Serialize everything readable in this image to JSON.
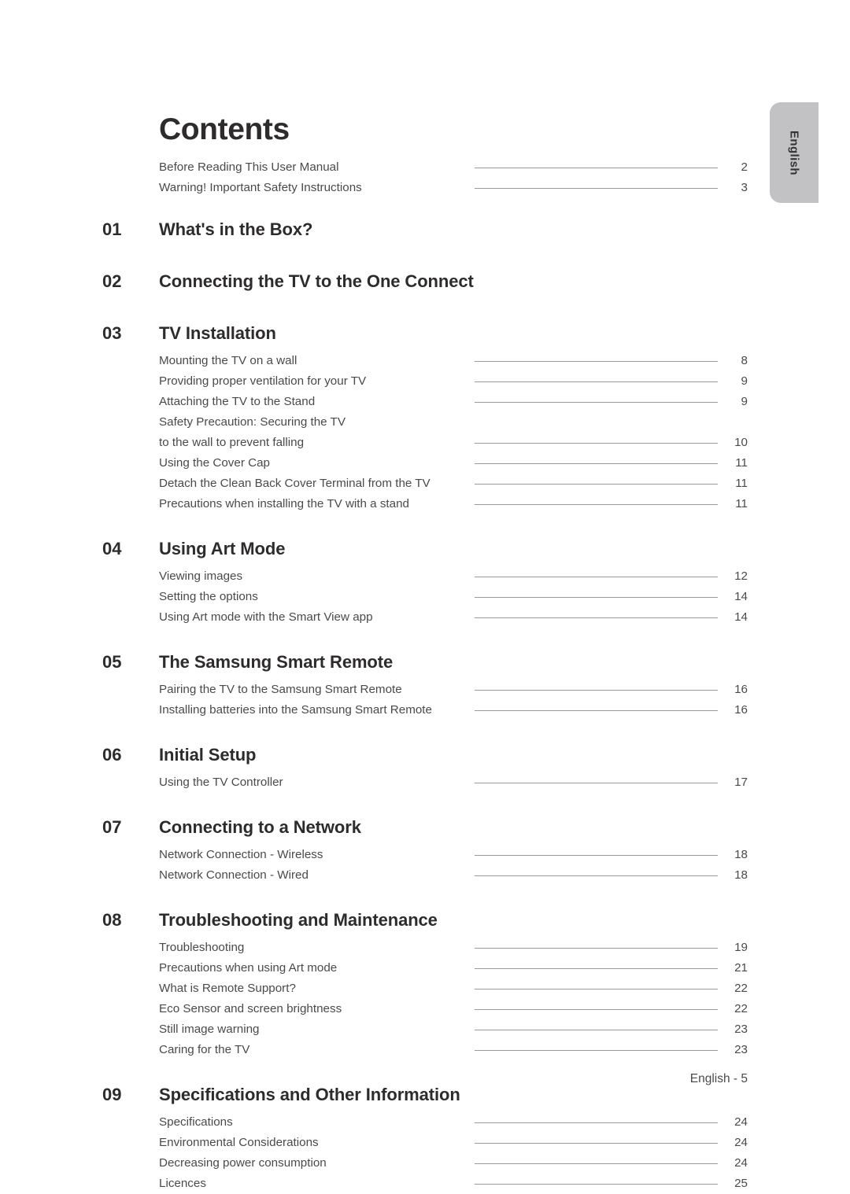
{
  "page": {
    "title": "Contents",
    "footer": "English - 5",
    "side_tab_label": "English",
    "side_tab_color": "#c2c2c4",
    "text_color": "#4a4a4d",
    "heading_color": "#2e2b2c",
    "leader_color": "#9b9b9e"
  },
  "preamble": [
    {
      "text": "Before Reading This User Manual",
      "page": "2"
    },
    {
      "text": "Warning! Important Safety Instructions",
      "page": "3"
    }
  ],
  "chapters": [
    {
      "number": "01",
      "title": "What's in the Box?",
      "entries": []
    },
    {
      "number": "02",
      "title": "Connecting the TV to the One Connect",
      "entries": []
    },
    {
      "number": "03",
      "title": "TV Installation",
      "entries": [
        {
          "text": "Mounting the TV on a wall",
          "page": "8"
        },
        {
          "text": "Providing proper ventilation for your TV",
          "page": "9"
        },
        {
          "text": "Attaching the TV to the Stand",
          "page": "9"
        },
        {
          "text": "Safety Precaution: Securing the TV",
          "page": "",
          "leader": false
        },
        {
          "text": "to the wall to prevent falling",
          "page": "10"
        },
        {
          "text": "Using the Cover Cap",
          "page": "11"
        },
        {
          "text": "Detach the Clean Back Cover Terminal from the TV",
          "page": "11"
        },
        {
          "text": "Precautions when installing the TV with a stand",
          "page": "11"
        }
      ]
    },
    {
      "number": "04",
      "title": "Using Art Mode",
      "entries": [
        {
          "text": "Viewing images",
          "page": "12"
        },
        {
          "text": "Setting the options",
          "page": "14"
        },
        {
          "text": "Using Art mode with the Smart View app",
          "page": "14"
        }
      ]
    },
    {
      "number": "05",
      "title": "The Samsung Smart Remote",
      "entries": [
        {
          "text": "Pairing the TV to the Samsung Smart Remote",
          "page": "16"
        },
        {
          "text": "Installing batteries into the Samsung Smart Remote",
          "page": "16"
        }
      ]
    },
    {
      "number": "06",
      "title": "Initial Setup",
      "entries": [
        {
          "text": "Using the TV Controller",
          "page": "17"
        }
      ]
    },
    {
      "number": "07",
      "title": "Connecting to a Network",
      "entries": [
        {
          "text": "Network Connection - Wireless",
          "page": "18"
        },
        {
          "text": "Network Connection - Wired",
          "page": "18"
        }
      ]
    },
    {
      "number": "08",
      "title": "Troubleshooting and Maintenance",
      "entries": [
        {
          "text": "Troubleshooting",
          "page": "19"
        },
        {
          "text": "Precautions when using Art mode",
          "page": "21"
        },
        {
          "text": "What is Remote Support?",
          "page": "22"
        },
        {
          "text": "Eco Sensor and screen brightness",
          "page": "22"
        },
        {
          "text": "Still image warning",
          "page": "23"
        },
        {
          "text": "Caring for the TV",
          "page": "23"
        }
      ]
    },
    {
      "number": "09",
      "title": "Specifications and Other Information",
      "entries": [
        {
          "text": "Specifications",
          "page": "24"
        },
        {
          "text": "Environmental Considerations",
          "page": "24"
        },
        {
          "text": "Decreasing power consumption",
          "page": "24"
        },
        {
          "text": "Licences",
          "page": "25"
        }
      ]
    }
  ]
}
